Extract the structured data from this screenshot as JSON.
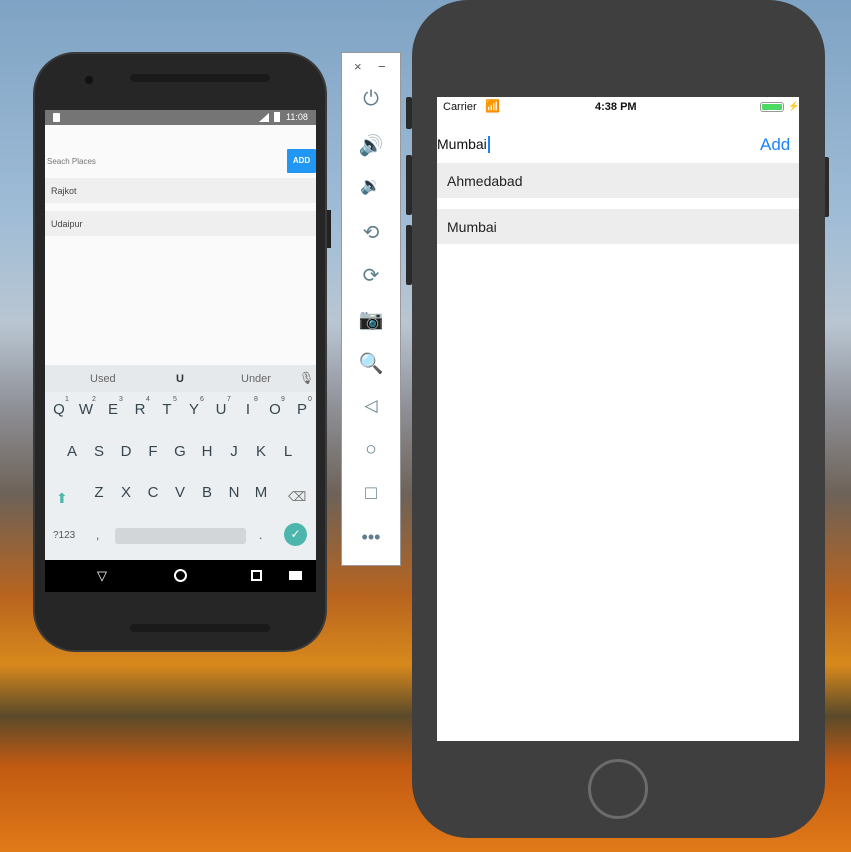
{
  "android": {
    "status_time": "11:08",
    "search": {
      "placeholder": "Seach Places",
      "value": ""
    },
    "add_label": "ADD",
    "places": [
      "Rajkot",
      "Udaipur"
    ],
    "keyboard": {
      "suggestions": [
        "Used",
        "U",
        "Under"
      ],
      "row1": [
        "Q",
        "W",
        "E",
        "R",
        "T",
        "Y",
        "U",
        "I",
        "O",
        "P"
      ],
      "row1_nums": [
        "1",
        "2",
        "3",
        "4",
        "5",
        "6",
        "7",
        "8",
        "9",
        "0"
      ],
      "row2": [
        "A",
        "S",
        "D",
        "F",
        "G",
        "H",
        "J",
        "K",
        "L"
      ],
      "row3": [
        "Z",
        "X",
        "C",
        "V",
        "B",
        "N",
        "M"
      ],
      "symbols_label": "?123",
      "comma": ",",
      "period": "."
    },
    "accent": "#2196f3"
  },
  "emulator_toolbar": {
    "close": "×",
    "minimize": "−",
    "icons": [
      "power-icon",
      "volume-up-icon",
      "volume-down-icon",
      "rotate-left-icon",
      "rotate-right-icon",
      "camera-icon",
      "zoom-icon",
      "back-icon",
      "home-icon",
      "overview-icon",
      "more-icon"
    ]
  },
  "ios": {
    "carrier": "Carrier",
    "time": "4:38 PM",
    "search": {
      "value": "Mumbai"
    },
    "add_label": "Add",
    "places": [
      "Ahmedabad",
      "Mumbai"
    ],
    "accent": "#1a82fb",
    "battery_color": "#4cd964"
  }
}
